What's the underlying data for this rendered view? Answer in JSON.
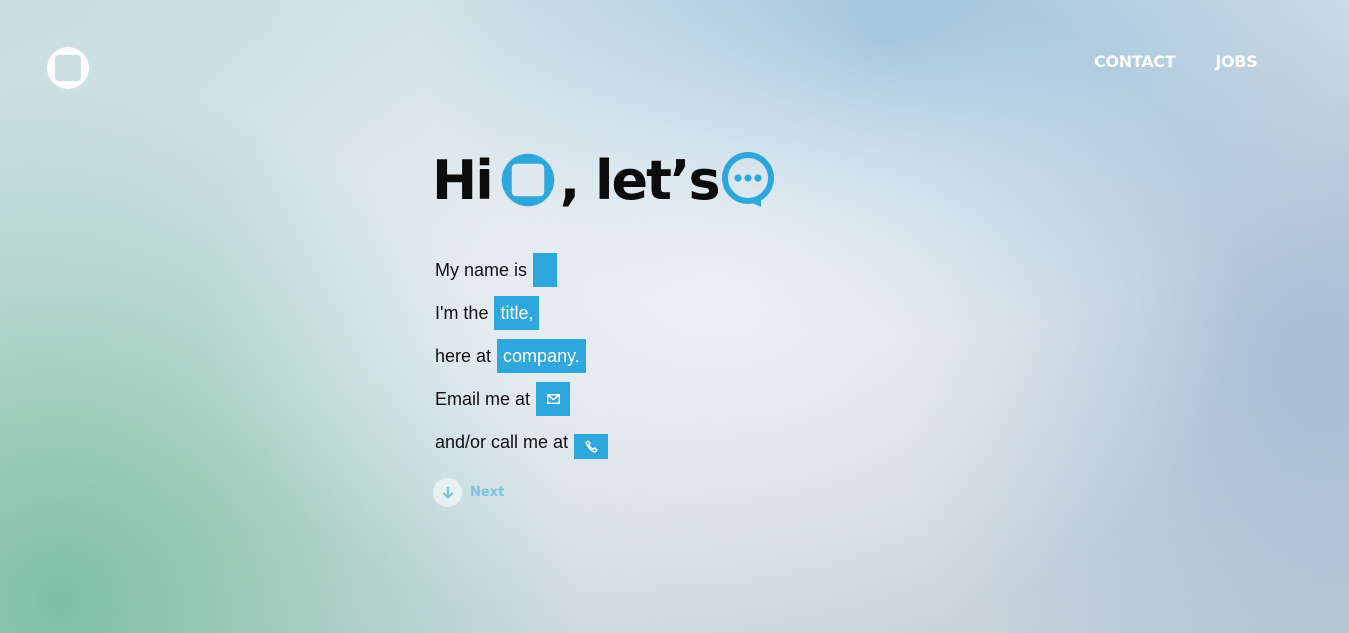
{
  "brand": {
    "logo_icon": "logo-icon",
    "accent_color": "#2ea8dc"
  },
  "nav": {
    "items": [
      {
        "label": "CONTACT"
      },
      {
        "label": "JOBS"
      }
    ]
  },
  "headline": {
    "part1": "Hi",
    "part2": ", let’s",
    "icon1": "logo-mark-icon",
    "icon2": "chat-bubble-icon"
  },
  "form": {
    "name": {
      "label": "My name is",
      "value": ""
    },
    "title": {
      "label": "I'm the",
      "value": "title,"
    },
    "company": {
      "label": "here at",
      "value": "company."
    },
    "email": {
      "label": "Email me at",
      "icon": "envelope-icon"
    },
    "phone": {
      "label": "and/or call me at",
      "icon": "phone-icon"
    }
  },
  "next": {
    "label": "Next",
    "icon": "arrow-down-icon"
  }
}
